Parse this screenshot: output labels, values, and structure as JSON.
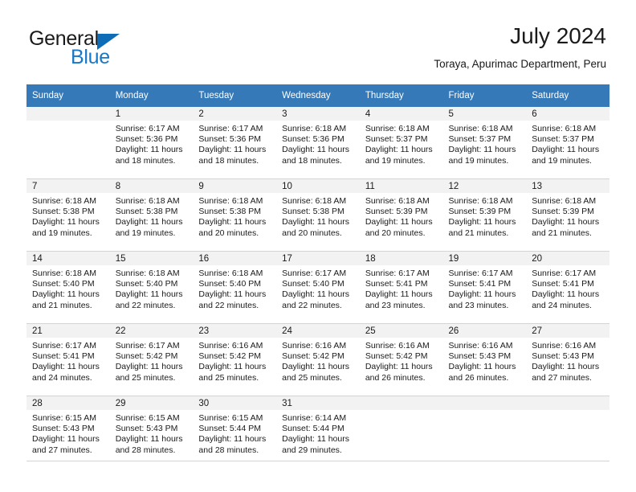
{
  "brand": {
    "name_part1": "General",
    "name_part2": "Blue",
    "logo_icon": "triangle-logo-icon",
    "accent_color": "#1878c8"
  },
  "header": {
    "title": "July 2024",
    "subtitle": "Toraya, Apurimac Department, Peru"
  },
  "calendar": {
    "header_bg": "#3579b8",
    "daynum_bg": "#f2f2f2",
    "weekday_headers": [
      "Sunday",
      "Monday",
      "Tuesday",
      "Wednesday",
      "Thursday",
      "Friday",
      "Saturday"
    ],
    "weeks": [
      [
        {
          "day": "",
          "lines": []
        },
        {
          "day": "1",
          "lines": [
            "Sunrise: 6:17 AM",
            "Sunset: 5:36 PM",
            "Daylight: 11 hours",
            "and 18 minutes."
          ]
        },
        {
          "day": "2",
          "lines": [
            "Sunrise: 6:17 AM",
            "Sunset: 5:36 PM",
            "Daylight: 11 hours",
            "and 18 minutes."
          ]
        },
        {
          "day": "3",
          "lines": [
            "Sunrise: 6:18 AM",
            "Sunset: 5:36 PM",
            "Daylight: 11 hours",
            "and 18 minutes."
          ]
        },
        {
          "day": "4",
          "lines": [
            "Sunrise: 6:18 AM",
            "Sunset: 5:37 PM",
            "Daylight: 11 hours",
            "and 19 minutes."
          ]
        },
        {
          "day": "5",
          "lines": [
            "Sunrise: 6:18 AM",
            "Sunset: 5:37 PM",
            "Daylight: 11 hours",
            "and 19 minutes."
          ]
        },
        {
          "day": "6",
          "lines": [
            "Sunrise: 6:18 AM",
            "Sunset: 5:37 PM",
            "Daylight: 11 hours",
            "and 19 minutes."
          ]
        }
      ],
      [
        {
          "day": "7",
          "lines": [
            "Sunrise: 6:18 AM",
            "Sunset: 5:38 PM",
            "Daylight: 11 hours",
            "and 19 minutes."
          ]
        },
        {
          "day": "8",
          "lines": [
            "Sunrise: 6:18 AM",
            "Sunset: 5:38 PM",
            "Daylight: 11 hours",
            "and 19 minutes."
          ]
        },
        {
          "day": "9",
          "lines": [
            "Sunrise: 6:18 AM",
            "Sunset: 5:38 PM",
            "Daylight: 11 hours",
            "and 20 minutes."
          ]
        },
        {
          "day": "10",
          "lines": [
            "Sunrise: 6:18 AM",
            "Sunset: 5:38 PM",
            "Daylight: 11 hours",
            "and 20 minutes."
          ]
        },
        {
          "day": "11",
          "lines": [
            "Sunrise: 6:18 AM",
            "Sunset: 5:39 PM",
            "Daylight: 11 hours",
            "and 20 minutes."
          ]
        },
        {
          "day": "12",
          "lines": [
            "Sunrise: 6:18 AM",
            "Sunset: 5:39 PM",
            "Daylight: 11 hours",
            "and 21 minutes."
          ]
        },
        {
          "day": "13",
          "lines": [
            "Sunrise: 6:18 AM",
            "Sunset: 5:39 PM",
            "Daylight: 11 hours",
            "and 21 minutes."
          ]
        }
      ],
      [
        {
          "day": "14",
          "lines": [
            "Sunrise: 6:18 AM",
            "Sunset: 5:40 PM",
            "Daylight: 11 hours",
            "and 21 minutes."
          ]
        },
        {
          "day": "15",
          "lines": [
            "Sunrise: 6:18 AM",
            "Sunset: 5:40 PM",
            "Daylight: 11 hours",
            "and 22 minutes."
          ]
        },
        {
          "day": "16",
          "lines": [
            "Sunrise: 6:18 AM",
            "Sunset: 5:40 PM",
            "Daylight: 11 hours",
            "and 22 minutes."
          ]
        },
        {
          "day": "17",
          "lines": [
            "Sunrise: 6:17 AM",
            "Sunset: 5:40 PM",
            "Daylight: 11 hours",
            "and 22 minutes."
          ]
        },
        {
          "day": "18",
          "lines": [
            "Sunrise: 6:17 AM",
            "Sunset: 5:41 PM",
            "Daylight: 11 hours",
            "and 23 minutes."
          ]
        },
        {
          "day": "19",
          "lines": [
            "Sunrise: 6:17 AM",
            "Sunset: 5:41 PM",
            "Daylight: 11 hours",
            "and 23 minutes."
          ]
        },
        {
          "day": "20",
          "lines": [
            "Sunrise: 6:17 AM",
            "Sunset: 5:41 PM",
            "Daylight: 11 hours",
            "and 24 minutes."
          ]
        }
      ],
      [
        {
          "day": "21",
          "lines": [
            "Sunrise: 6:17 AM",
            "Sunset: 5:41 PM",
            "Daylight: 11 hours",
            "and 24 minutes."
          ]
        },
        {
          "day": "22",
          "lines": [
            "Sunrise: 6:17 AM",
            "Sunset: 5:42 PM",
            "Daylight: 11 hours",
            "and 25 minutes."
          ]
        },
        {
          "day": "23",
          "lines": [
            "Sunrise: 6:16 AM",
            "Sunset: 5:42 PM",
            "Daylight: 11 hours",
            "and 25 minutes."
          ]
        },
        {
          "day": "24",
          "lines": [
            "Sunrise: 6:16 AM",
            "Sunset: 5:42 PM",
            "Daylight: 11 hours",
            "and 25 minutes."
          ]
        },
        {
          "day": "25",
          "lines": [
            "Sunrise: 6:16 AM",
            "Sunset: 5:42 PM",
            "Daylight: 11 hours",
            "and 26 minutes."
          ]
        },
        {
          "day": "26",
          "lines": [
            "Sunrise: 6:16 AM",
            "Sunset: 5:43 PM",
            "Daylight: 11 hours",
            "and 26 minutes."
          ]
        },
        {
          "day": "27",
          "lines": [
            "Sunrise: 6:16 AM",
            "Sunset: 5:43 PM",
            "Daylight: 11 hours",
            "and 27 minutes."
          ]
        }
      ],
      [
        {
          "day": "28",
          "lines": [
            "Sunrise: 6:15 AM",
            "Sunset: 5:43 PM",
            "Daylight: 11 hours",
            "and 27 minutes."
          ]
        },
        {
          "day": "29",
          "lines": [
            "Sunrise: 6:15 AM",
            "Sunset: 5:43 PM",
            "Daylight: 11 hours",
            "and 28 minutes."
          ]
        },
        {
          "day": "30",
          "lines": [
            "Sunrise: 6:15 AM",
            "Sunset: 5:44 PM",
            "Daylight: 11 hours",
            "and 28 minutes."
          ]
        },
        {
          "day": "31",
          "lines": [
            "Sunrise: 6:14 AM",
            "Sunset: 5:44 PM",
            "Daylight: 11 hours",
            "and 29 minutes."
          ]
        },
        {
          "day": "",
          "lines": []
        },
        {
          "day": "",
          "lines": []
        },
        {
          "day": "",
          "lines": []
        }
      ]
    ]
  }
}
